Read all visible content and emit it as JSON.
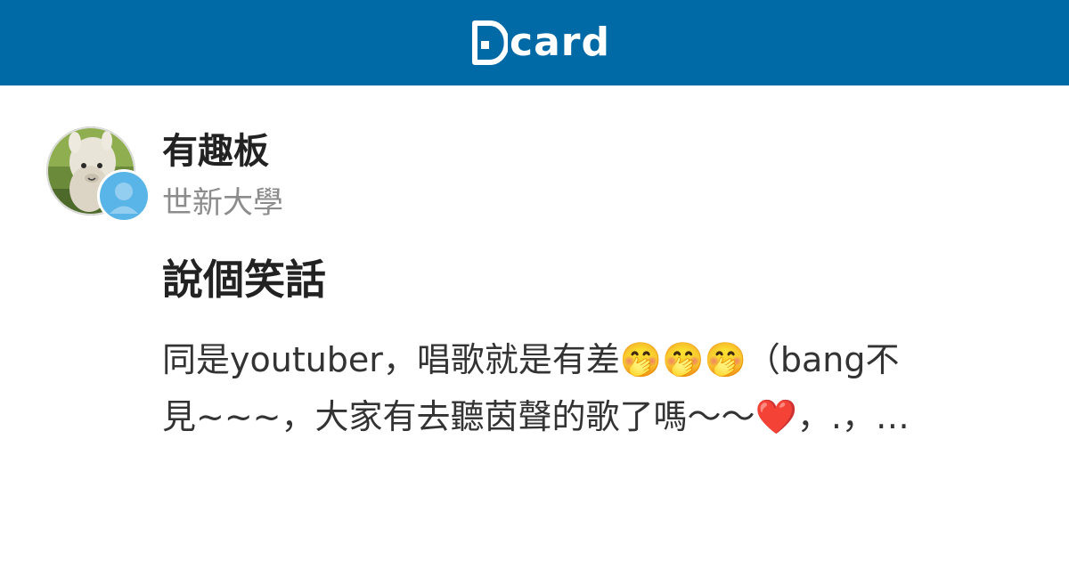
{
  "header": {
    "logo_text": "card",
    "brand_color": "#006aa6"
  },
  "author": {
    "avatar_icon": "alpaca-avatar",
    "badge_icon": "anonymous-user-icon",
    "forum": "有趣板",
    "school": "世新大學"
  },
  "post": {
    "title": "說個笑話",
    "excerpt_line1": "同是youtuber，唱歌就是有差🤭🤭🤭（bang不",
    "excerpt_line2": "見~~~，大家有去聽茵聲的歌了嗎〜〜❤️，.，…"
  }
}
